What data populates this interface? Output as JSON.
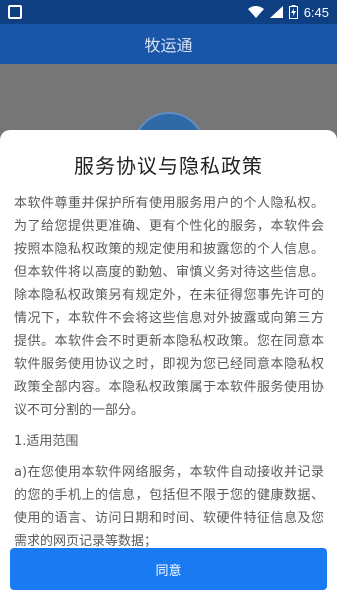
{
  "status_bar": {
    "time": "6:45",
    "icons": [
      "wifi-icon",
      "signal-icon",
      "battery-charging-icon"
    ]
  },
  "app_bar": {
    "title": "牧运通"
  },
  "dialog": {
    "title": "服务协议与隐私政策",
    "paragraphs": [
      "本软件尊重并保护所有使用服务用户的个人隐私权。为了给您提供更准确、更有个性化的服务，本软件会按照本隐私权政策的规定使用和披露您的个人信息。但本软件将以高度的勤勉、审慎义务对待这些信息。除本隐私权政策另有规定外，在未征得您事先许可的情况下，本软件不会将这些信息对外披露或向第三方提供。本软件会不时更新本隐私权政策。您在同意本软件服务使用协议之时，即视为您已经同意本隐私权政策全部内容。本隐私权政策属于本软件服务使用协议不可分割的一部分。",
      "1.适用范围",
      "a)在您使用本软件网络服务，本软件自动接收并记录的您的手机上的信息，包括但不限于您的健康数据、使用的语言、访问日期和时间、软硬件特征信息及您需求的网页记录等数据；"
    ],
    "agree_label": "同意"
  }
}
